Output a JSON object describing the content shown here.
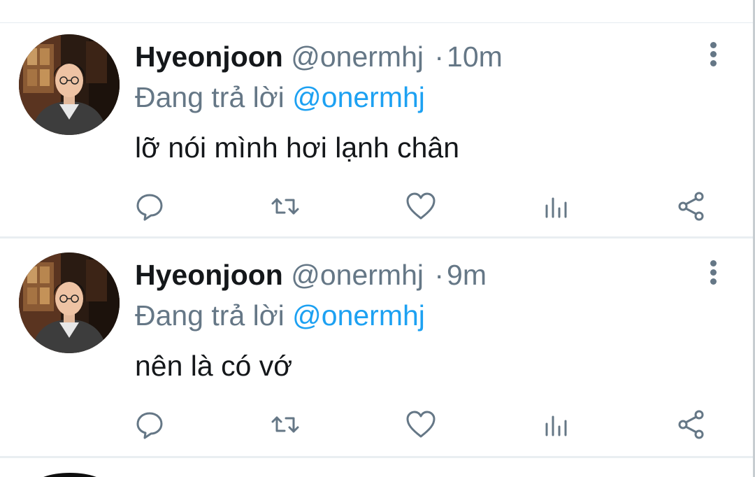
{
  "tweets": [
    {
      "display_name": "Hyeonjoon",
      "handle": "@onermhj",
      "separator": "·",
      "time": "10m",
      "reply_prefix": "Đang trả lời",
      "reply_to": "@onermhj",
      "text": "lỡ nói mình hơi lạnh chân",
      "icons": {
        "avatar": "profile-photo",
        "more": "vertical-dots-icon",
        "reply": "comment-icon",
        "retweet": "retweet-icon",
        "like": "heart-icon",
        "stats": "analytics-icon",
        "share": "share-icon"
      }
    },
    {
      "display_name": "Hyeonjoon",
      "handle": "@onermhj",
      "separator": "·",
      "time": "9m",
      "reply_prefix": "Đang trả lời",
      "reply_to": "@onermhj",
      "text": "nên là có vớ",
      "icons": {
        "avatar": "profile-photo",
        "more": "vertical-dots-icon",
        "reply": "comment-icon",
        "retweet": "retweet-icon",
        "like": "heart-icon",
        "stats": "analytics-icon",
        "share": "share-icon"
      }
    }
  ],
  "colors": {
    "text_primary": "#14171a",
    "text_secondary": "#657786",
    "accent_link": "#1da1f2",
    "divider": "#e9eef1"
  }
}
